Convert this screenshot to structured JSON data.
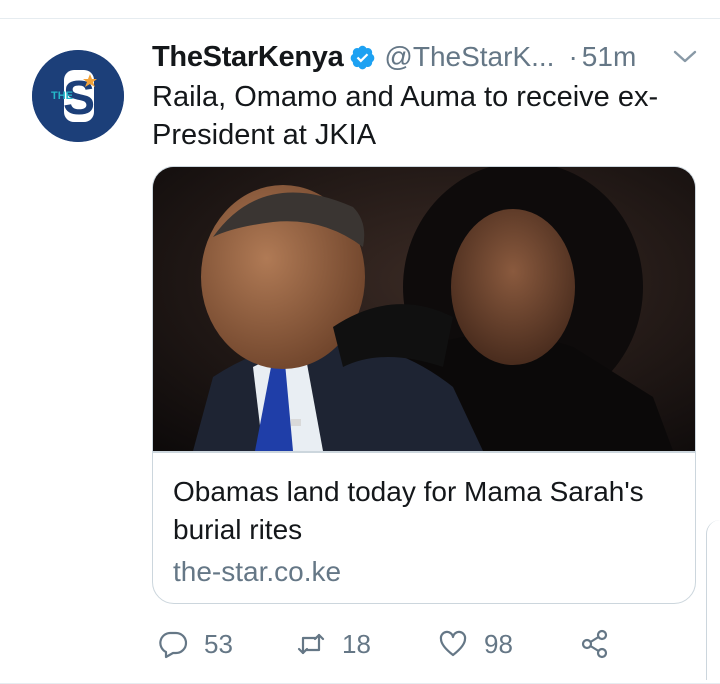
{
  "tweet": {
    "display_name": "TheStarKenya",
    "handle": "@TheStarK...",
    "separator": "·",
    "time": "51m",
    "text": "Raila, Omamo and Auma to receive ex-President at JKIA",
    "avatar_logo": "S",
    "avatar_tag": "THE",
    "icons": {
      "verified": "verified-badge-icon",
      "more": "chevron-down-icon"
    }
  },
  "card": {
    "title": "Obamas land today for Mama Sarah's burial rites",
    "domain": "the-star.co.ke"
  },
  "actions": {
    "reply_count": "53",
    "retweet_count": "18",
    "like_count": "98"
  },
  "colors": {
    "verified_blue": "#1da1f2",
    "muted_text": "#657786",
    "primary_text": "#14171a",
    "avatar_bg": "#1c3f79",
    "avatar_accent": "#25b7c9",
    "divider": "#e6ecf0"
  }
}
